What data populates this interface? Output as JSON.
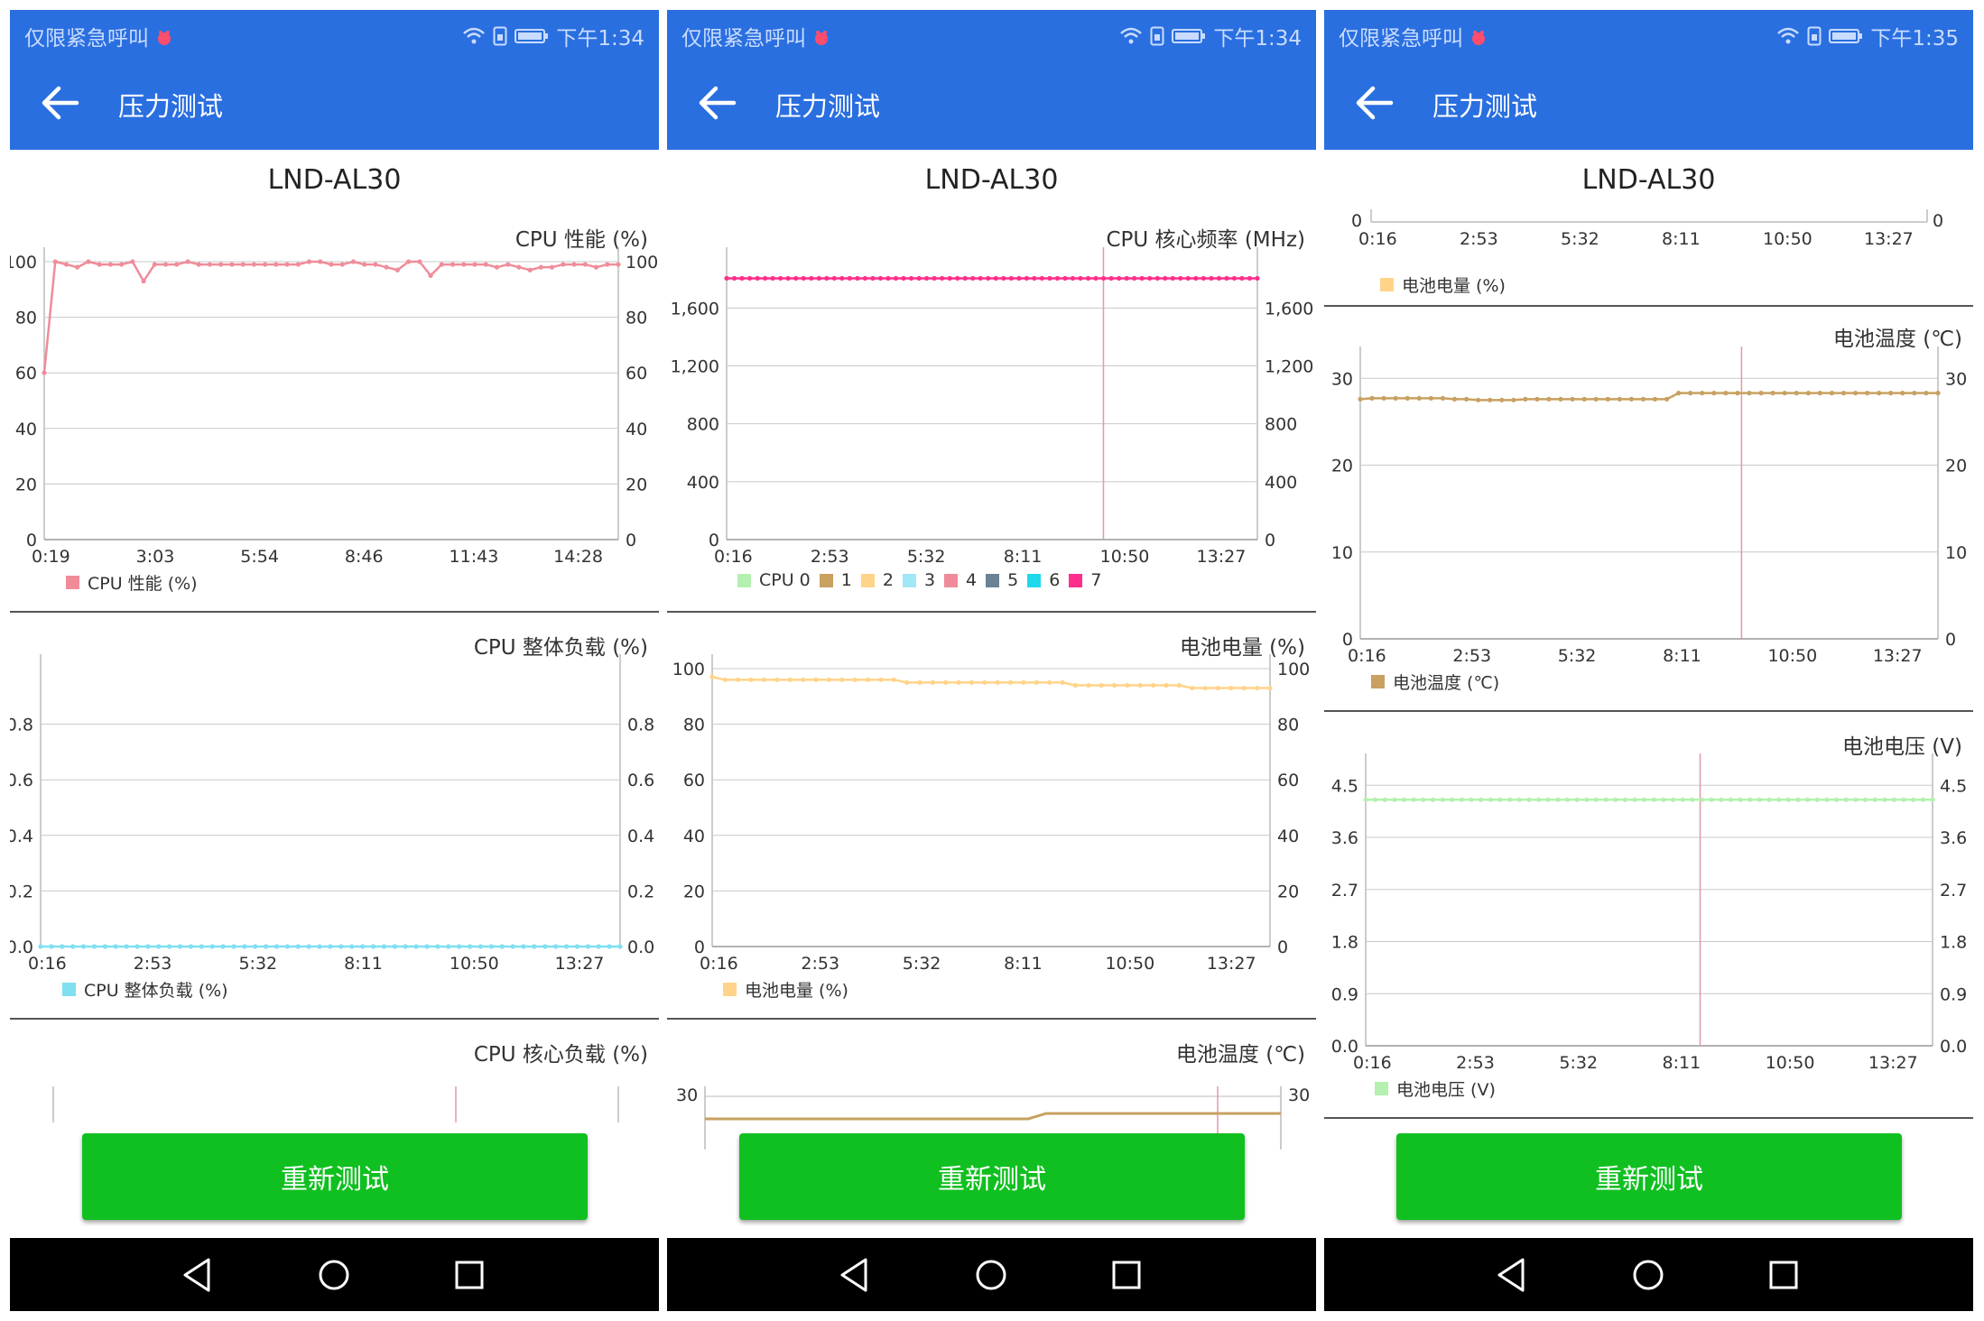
{
  "colors": {
    "app_bar": "#2a6fe0",
    "retest_button": "#10c020",
    "cpu_perf": "#f08c9a",
    "cpu_load": "#7fe0f0",
    "cpu_freq_core7": "#ff2d8c",
    "battery_level": "#ffd48a",
    "battery_temp": "#c8a060",
    "battery_voltage": "#b4f0b0"
  },
  "phones": [
    {
      "status": {
        "left": "仅限紧急呼叫",
        "time": "下午1:34",
        "icons": [
          "alert-icon",
          "wifi-icon",
          "sim-icon",
          "battery-icon"
        ]
      },
      "title": "压力测试",
      "device": "LND-AL30",
      "retest": "重新测试",
      "nav": [
        "back-triangle-icon",
        "home-circle-icon",
        "recents-square-icon"
      ]
    },
    {
      "status": {
        "left": "仅限紧急呼叫",
        "time": "下午1:34",
        "icons": [
          "alert-icon",
          "wifi-icon",
          "sim-icon",
          "battery-icon"
        ]
      },
      "title": "压力测试",
      "device": "LND-AL30",
      "retest": "重新测试",
      "nav": [
        "back-triangle-icon",
        "home-circle-icon",
        "recents-square-icon"
      ]
    },
    {
      "status": {
        "left": "仅限紧急呼叫",
        "time": "下午1:35",
        "icons": [
          "alert-icon",
          "wifi-icon",
          "sim-icon",
          "battery-icon"
        ]
      },
      "title": "压力测试",
      "device": "LND-AL30",
      "retest": "重新测试",
      "nav": [
        "back-triangle-icon",
        "home-circle-icon",
        "recents-square-icon"
      ]
    }
  ],
  "chart_data": [
    {
      "id": "p1_cpu_perf",
      "type": "line",
      "title": "CPU 性能 (%)",
      "x_ticks": [
        "0:19",
        "3:03",
        "5:54",
        "8:46",
        "11:43",
        "14:28"
      ],
      "y_ticks": [
        "0",
        "20",
        "40",
        "60",
        "80",
        "100"
      ],
      "ylim": [
        0,
        100
      ],
      "legend": [
        {
          "label": "CPU 性能 (%)",
          "color": "#f08c9a"
        }
      ],
      "series": [
        {
          "color": "#f08c9a",
          "markers": true,
          "values": [
            60,
            100,
            99,
            98,
            100,
            99,
            99,
            99,
            100,
            93,
            99,
            99,
            99,
            100,
            99,
            99,
            99,
            99,
            99,
            99,
            99,
            99,
            99,
            99,
            100,
            100,
            99,
            99,
            100,
            99,
            99,
            98,
            97,
            100,
            100,
            95,
            99,
            99,
            99,
            99,
            99,
            98,
            99,
            98,
            97,
            98,
            98,
            99,
            99,
            99,
            98,
            99,
            99
          ]
        }
      ],
      "guide_x": null
    },
    {
      "id": "p1_cpu_load",
      "type": "line",
      "title": "CPU 整体负载 (%)",
      "x_ticks": [
        "0:16",
        "2:53",
        "5:32",
        "8:11",
        "10:50",
        "13:27"
      ],
      "y_ticks": [
        "0.0",
        "0.2",
        "0.4",
        "0.6",
        "0.8"
      ],
      "ylim": [
        0,
        1
      ],
      "legend": [
        {
          "label": "CPU 整体负载 (%)",
          "color": "#7fe0f0"
        }
      ],
      "series": [
        {
          "color": "#7fe0f0",
          "markers": true,
          "constant": 0,
          "points": 55
        }
      ],
      "guide_x": null
    },
    {
      "id": "p1_cpu_core_load",
      "type": "line",
      "title": "CPU 核心负载 (%)",
      "partial": true
    },
    {
      "id": "p2_cpu_freq",
      "type": "line",
      "title": "CPU 核心频率 (MHz)",
      "x_ticks": [
        "0:16",
        "2:53",
        "5:32",
        "8:11",
        "10:50",
        "13:27"
      ],
      "y_ticks": [
        "0",
        "400",
        "800",
        "1,200",
        "1,600"
      ],
      "ylim": [
        0,
        1920
      ],
      "legend": [
        {
          "label": "CPU 0",
          "color": "#b4f0b0"
        },
        {
          "label": "1",
          "color": "#c8a060"
        },
        {
          "label": "2",
          "color": "#ffd48a"
        },
        {
          "label": "3",
          "color": "#a0e8f5"
        },
        {
          "label": "4",
          "color": "#f08c9a"
        },
        {
          "label": "5",
          "color": "#6a8294"
        },
        {
          "label": "6",
          "color": "#20d8ec"
        },
        {
          "label": "7",
          "color": "#ff2d8c"
        }
      ],
      "series": [
        {
          "color": "#ff2d8c",
          "markers": true,
          "constant": 1805,
          "points": 70
        }
      ],
      "guide_x": 0.71
    },
    {
      "id": "p2_battery_level",
      "type": "line",
      "title": "电池电量 (%)",
      "x_ticks": [
        "0:16",
        "2:53",
        "5:32",
        "8:11",
        "10:50",
        "13:27"
      ],
      "y_ticks": [
        "0",
        "20",
        "40",
        "60",
        "80",
        "100"
      ],
      "ylim": [
        0,
        100
      ],
      "legend": [
        {
          "label": "电池电量 (%)",
          "color": "#ffd48a"
        }
      ],
      "series": [
        {
          "color": "#ffd48a",
          "markers": true,
          "values": [
            97,
            96,
            96,
            96,
            96,
            96,
            96,
            96,
            96,
            96,
            96,
            96,
            96,
            96,
            96,
            95,
            95,
            95,
            95,
            95,
            95,
            95,
            95,
            95,
            95,
            95,
            95,
            95,
            94,
            94,
            94,
            94,
            94,
            94,
            94,
            94,
            94,
            93,
            93,
            93,
            93,
            93,
            93,
            93
          ]
        }
      ],
      "guide_x": null
    },
    {
      "id": "p2_battery_temp",
      "type": "line",
      "title": "电池温度 (℃)",
      "partial": true
    },
    {
      "id": "p3_battery_level_tail",
      "type": "line",
      "partial": true,
      "x_ticks": [
        "0:16",
        "2:53",
        "5:32",
        "8:11",
        "10:50",
        "13:27"
      ],
      "legend": [
        {
          "label": "电池电量 (%)",
          "color": "#ffd48a"
        }
      ]
    },
    {
      "id": "p3_battery_temp",
      "type": "line",
      "title": "电池温度 (℃)",
      "x_ticks": [
        "0:16",
        "2:53",
        "5:32",
        "8:11",
        "10:50",
        "13:27"
      ],
      "y_ticks": [
        "0",
        "10",
        "20",
        "30"
      ],
      "ylim": [
        0,
        32
      ],
      "legend": [
        {
          "label": "电池温度 (℃)",
          "color": "#c8a060"
        }
      ],
      "series": [
        {
          "color": "#c8a060",
          "markers": true,
          "values": [
            27.6,
            27.7,
            27.7,
            27.7,
            27.7,
            27.7,
            27.7,
            27.7,
            27.6,
            27.6,
            27.5,
            27.5,
            27.5,
            27.5,
            27.6,
            27.6,
            27.6,
            27.6,
            27.6,
            27.6,
            27.6,
            27.6,
            27.6,
            27.6,
            27.6,
            27.6,
            27.6,
            28.3,
            28.3,
            28.3,
            28.3,
            28.3,
            28.3,
            28.3,
            28.3,
            28.3,
            28.3,
            28.3,
            28.3,
            28.3,
            28.3,
            28.3,
            28.3,
            28.3,
            28.3,
            28.3,
            28.3,
            28.3,
            28.3,
            28.3
          ]
        }
      ],
      "guide_x": 0.66
    },
    {
      "id": "p3_battery_voltage",
      "type": "line",
      "title": "电池电压 (V)",
      "x_ticks": [
        "0:16",
        "2:53",
        "5:32",
        "8:11",
        "10:50",
        "13:27"
      ],
      "y_ticks": [
        "0.0",
        "0.9",
        "1.8",
        "2.7",
        "3.6",
        "4.5"
      ],
      "ylim": [
        0,
        4.8
      ],
      "legend": [
        {
          "label": "电池电压 (V)",
          "color": "#b4f0b0"
        }
      ],
      "series": [
        {
          "color": "#b4f0b0",
          "markers": true,
          "constant": 4.25,
          "points": 60
        }
      ],
      "guide_x": 0.59
    }
  ]
}
